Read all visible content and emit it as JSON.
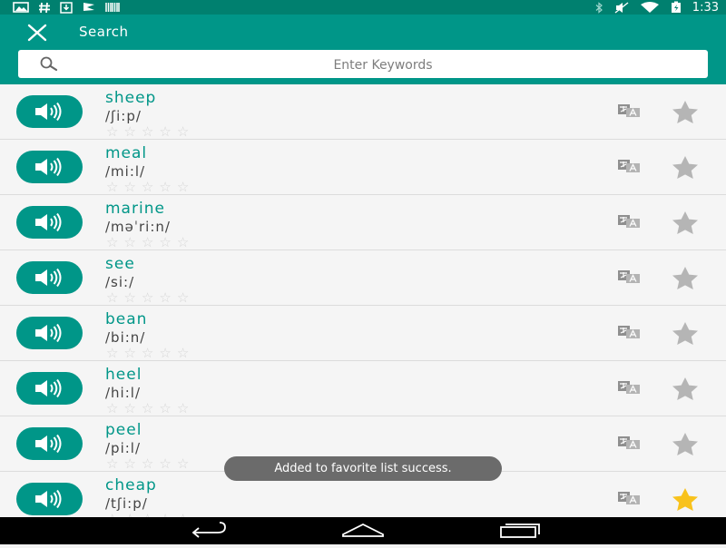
{
  "status_bar": {
    "time": "1:33",
    "left_icons": [
      "gallery-icon",
      "hash-icon",
      "download-icon",
      "flag-icon",
      "barcode-icon"
    ],
    "right_icons": [
      "bluetooth-icon",
      "mute-icon",
      "wifi-icon",
      "battery-icon"
    ]
  },
  "appbar": {
    "title": "Search"
  },
  "search": {
    "placeholder": "Enter Keywords",
    "value": ""
  },
  "colors": {
    "primary": "#009688",
    "status_bar": "#00806f",
    "favorite_active": "#f8c21c",
    "favorite_inactive": "#b5b5b5"
  },
  "words": [
    {
      "word": "sheep",
      "phonetic": "/ʃi:p/",
      "stars": 0,
      "favorite": false
    },
    {
      "word": "meal",
      "phonetic": "/mi:l/",
      "stars": 0,
      "favorite": false
    },
    {
      "word": "marine",
      "phonetic": "/məˈri:n/",
      "stars": 0,
      "favorite": false
    },
    {
      "word": "see",
      "phonetic": "/si:/",
      "stars": 0,
      "favorite": false
    },
    {
      "word": "bean",
      "phonetic": "/bi:n/",
      "stars": 0,
      "favorite": false
    },
    {
      "word": "heel",
      "phonetic": "/hi:l/",
      "stars": 0,
      "favorite": false
    },
    {
      "word": "peel",
      "phonetic": "/pi:l/",
      "stars": 0,
      "favorite": false
    },
    {
      "word": "cheap",
      "phonetic": "/tʃi:p/",
      "stars": 0,
      "favorite": true
    }
  ],
  "toast": {
    "message": "Added to favorite list success."
  },
  "nav_bar": {
    "buttons": [
      "back-icon",
      "home-icon",
      "recents-icon"
    ]
  }
}
